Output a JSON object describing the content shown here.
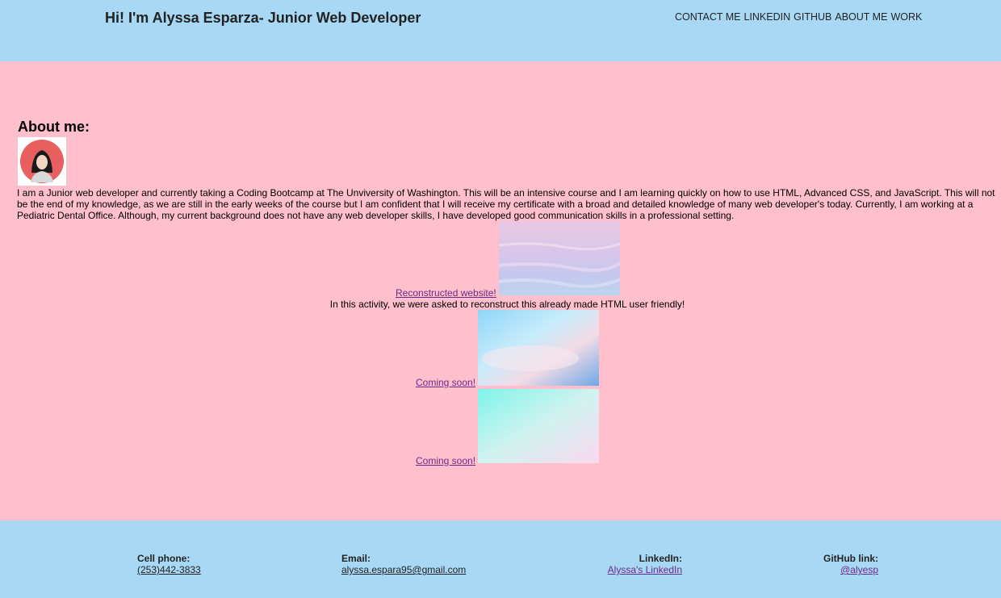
{
  "header": {
    "title": "Hi! I'm Alyssa Esparza- Junior Web Developer",
    "nav": [
      "CONTACT ME",
      "LINKEDIN",
      "GITHUB",
      "ABOUT ME",
      "WORK"
    ]
  },
  "about": {
    "heading": "About me:",
    "text": "I am a Junior web developer and currently taking a Coding Bootcamp at The Unviversity of Washington. This will be an intensive course and I am learning quickly on how to use HTML, Advanced CSS, and JavaScript. This will not be the end of my knowledge, as we are still in the early weeks of the course but I am confident that I will receive my certificate with a broad and detailed knowledge of many web developer's today. Currently, I am working at a Pediatric Dental Office. Although, my current background does not have any web developer skills, I have developed good communication skills in a professional setting."
  },
  "work": {
    "items": [
      {
        "link": "Reconstructed website! ",
        "description": "In this activity, we were asked to reconstruct this already made HTML user friendly!"
      },
      {
        "link": "Coming soon!"
      },
      {
        "link": "Coming soon!"
      }
    ]
  },
  "footer": {
    "phone": {
      "label": "Cell phone:",
      "value": "(253)442-3833"
    },
    "email": {
      "label": "Email:",
      "value": "alyssa.espara95@gmail.com"
    },
    "linkedin": {
      "label": "LinkedIn:",
      "value": "Alyssa's LinkedIn"
    },
    "github": {
      "label": "GitHub link:",
      "value": "@alyesp"
    }
  },
  "colors": {
    "header_bg": "#a8d8f4",
    "page_bg": "#ffbfcd",
    "link": "#6b2a88"
  }
}
